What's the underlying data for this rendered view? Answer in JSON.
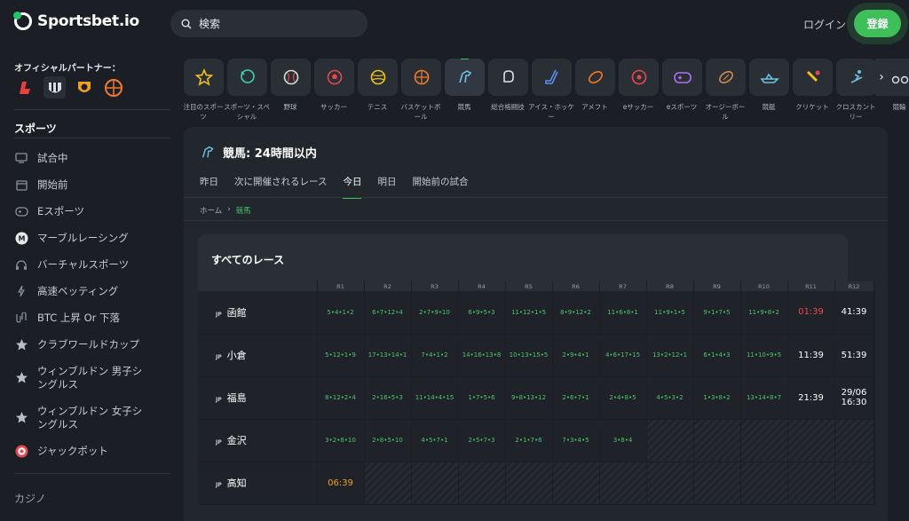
{
  "header": {
    "logo": "Sportsbet.io",
    "search_placeholder": "検索",
    "login": "ログイン",
    "register": "登録"
  },
  "sidebar": {
    "partners_title": "オフィシャルパートナー：",
    "partners": [
      {
        "icon": "laliga-logo",
        "color": "#e8413c"
      },
      {
        "icon": "newcastle-logo",
        "color": "#d9dde2"
      },
      {
        "icon": "hull-city-logo",
        "color": "#f0a020"
      },
      {
        "icon": "basketball-logo",
        "color": "#f07a2a"
      }
    ],
    "sports_title": "スポーツ",
    "items": [
      {
        "label": "試合中",
        "icon": "monitor-icon"
      },
      {
        "label": "開始前",
        "icon": "calendar-icon"
      },
      {
        "label": "Eスポーツ",
        "icon": "gamepad-icon"
      },
      {
        "label": "マーブルレーシング",
        "icon": "marble-icon"
      },
      {
        "label": "バーチャルスポーツ",
        "icon": "headset-icon"
      },
      {
        "label": "高速ベッティング",
        "icon": "lightning-icon"
      },
      {
        "label": "BTC 上昇 Or 下落",
        "icon": "bitcoin-icon"
      },
      {
        "label": "クラブワールドカップ",
        "icon": "star-icon"
      },
      {
        "label": "ウィンブルドン 男子シングルス",
        "icon": "star-icon"
      },
      {
        "label": "ウィンブルドン 女子シングルス",
        "icon": "star-icon"
      },
      {
        "label": "ジャックポット",
        "icon": "target-icon"
      }
    ],
    "casino_title": "カジノ"
  },
  "sport_strip": [
    {
      "label": "注目のスポーツ",
      "icon": "star-icon",
      "color": "#f0c020"
    },
    {
      "label": "スポーツ・スペシャル",
      "icon": "balloon-icon",
      "color": "#3fd0b0"
    },
    {
      "label": "野球",
      "icon": "baseball-icon",
      "color": "#d8d8d8"
    },
    {
      "label": "サッカー",
      "icon": "soccer-icon",
      "color": "#e5484d"
    },
    {
      "label": "テニス",
      "icon": "tennis-icon",
      "color": "#f0c020"
    },
    {
      "label": "バスケットボール",
      "icon": "basketball-icon",
      "color": "#f07a2a"
    },
    {
      "label": "競馬",
      "icon": "horse-icon",
      "color": "#6fc0e0"
    },
    {
      "label": "総合格闘技",
      "icon": "glove-icon",
      "color": "#e0e0e0"
    },
    {
      "label": "アイス・ホッケー",
      "icon": "hockey-icon",
      "color": "#5a8ef0"
    },
    {
      "label": "アメフト",
      "icon": "football-icon",
      "color": "#f07a2a"
    },
    {
      "label": "eサッカー",
      "icon": "esoccer-icon",
      "color": "#e5484d"
    },
    {
      "label": "eスポーツ",
      "icon": "controller-icon",
      "color": "#b070f0"
    },
    {
      "label": "オージーボール",
      "icon": "aussie-ball-icon",
      "color": "#d08a50"
    },
    {
      "label": "競艇",
      "icon": "boat-icon",
      "color": "#6fc0e0"
    },
    {
      "label": "クリケット",
      "icon": "cricket-icon",
      "color": "#f0c020"
    },
    {
      "label": "クロスカントリー",
      "icon": "skier-icon",
      "color": "#6fc0e0"
    },
    {
      "label": "競輪",
      "icon": "bike-icon",
      "color": "#e0e0e0"
    }
  ],
  "panel": {
    "title": "競馬: 24時間以内",
    "tabs": [
      "昨日",
      "次に開催されるレース",
      "今日",
      "明日",
      "開始前の試合"
    ],
    "active_tab": 2,
    "breadcrumb": {
      "home": "ホーム",
      "current": "競馬"
    },
    "races_title": "すべてのレース"
  },
  "race_table": {
    "columns": [
      "R1",
      "R2",
      "R3",
      "R4",
      "R5",
      "R6",
      "R7",
      "R8",
      "R9",
      "R10",
      "R11",
      "R12"
    ],
    "rows": [
      {
        "country": "JP",
        "venue": "函館",
        "cells": [
          {
            "v": "5•4•1•2",
            "k": "odds"
          },
          {
            "v": "6•7•12•4",
            "k": "odds"
          },
          {
            "v": "2•7•9•10",
            "k": "odds"
          },
          {
            "v": "6•9•5•3",
            "k": "odds"
          },
          {
            "v": "11•12•1•5",
            "k": "odds"
          },
          {
            "v": "8•9•12•2",
            "k": "odds"
          },
          {
            "v": "11•6•8•1",
            "k": "odds"
          },
          {
            "v": "11•9•1•5",
            "k": "odds"
          },
          {
            "v": "9•1•7•5",
            "k": "odds"
          },
          {
            "v": "11•9•8•2",
            "k": "odds"
          },
          {
            "v": "01:39",
            "k": "red"
          },
          {
            "v": "41:39",
            "k": "white"
          }
        ]
      },
      {
        "country": "JP",
        "venue": "小倉",
        "cells": [
          {
            "v": "5•12•1•9",
            "k": "odds"
          },
          {
            "v": "17•13•14•1",
            "k": "odds"
          },
          {
            "v": "7•4•1•2",
            "k": "odds"
          },
          {
            "v": "14•16•13•8",
            "k": "odds"
          },
          {
            "v": "10•13•15•5",
            "k": "odds"
          },
          {
            "v": "2•9•4•1",
            "k": "odds"
          },
          {
            "v": "4•6•17•15",
            "k": "odds"
          },
          {
            "v": "13•2•12•1",
            "k": "odds"
          },
          {
            "v": "6•1•4•3",
            "k": "odds"
          },
          {
            "v": "11•10•9•5",
            "k": "odds"
          },
          {
            "v": "11:39",
            "k": "white"
          },
          {
            "v": "51:39",
            "k": "white"
          }
        ]
      },
      {
        "country": "JP",
        "venue": "福島",
        "cells": [
          {
            "v": "8•12•2•4",
            "k": "odds"
          },
          {
            "v": "2•16•5•3",
            "k": "odds"
          },
          {
            "v": "11•14•4•15",
            "k": "odds"
          },
          {
            "v": "1•7•5•6",
            "k": "odds"
          },
          {
            "v": "9•8•13•12",
            "k": "odds"
          },
          {
            "v": "2•6•7•1",
            "k": "odds"
          },
          {
            "v": "2•4•8•5",
            "k": "odds"
          },
          {
            "v": "4•5•3•2",
            "k": "odds"
          },
          {
            "v": "1•3•8•2",
            "k": "odds"
          },
          {
            "v": "13•14•8•7",
            "k": "odds"
          },
          {
            "v": "21:39",
            "k": "white"
          },
          {
            "v": "29/06\n16:30",
            "k": "white"
          }
        ]
      },
      {
        "country": "JP",
        "venue": "金沢",
        "cells": [
          {
            "v": "3•2•8•10",
            "k": "odds"
          },
          {
            "v": "2•8•5•10",
            "k": "odds"
          },
          {
            "v": "4•5•7•1",
            "k": "odds"
          },
          {
            "v": "2•5•7•3",
            "k": "odds"
          },
          {
            "v": "2•1•7•6",
            "k": "odds"
          },
          {
            "v": "7•3•4•5",
            "k": "odds"
          },
          {
            "v": "3•8•4",
            "k": "odds"
          },
          {
            "v": "",
            "k": "empty"
          },
          {
            "v": "",
            "k": "empty"
          },
          {
            "v": "",
            "k": "empty"
          },
          {
            "v": "",
            "k": "empty"
          },
          {
            "v": "",
            "k": "empty"
          }
        ]
      },
      {
        "country": "JP",
        "venue": "高知",
        "cells": [
          {
            "v": "06:39",
            "k": "orange"
          },
          {
            "v": "",
            "k": "empty"
          },
          {
            "v": "",
            "k": "empty"
          },
          {
            "v": "",
            "k": "empty"
          },
          {
            "v": "",
            "k": "empty"
          },
          {
            "v": "",
            "k": "empty"
          },
          {
            "v": "",
            "k": "empty"
          },
          {
            "v": "",
            "k": "empty"
          },
          {
            "v": "",
            "k": "empty"
          },
          {
            "v": "",
            "k": "empty"
          },
          {
            "v": "",
            "k": "empty"
          },
          {
            "v": "",
            "k": "empty"
          }
        ]
      }
    ]
  },
  "colors": {
    "accent": "#3fbf5a",
    "background": "#1b1f25",
    "panel": "#22272e"
  }
}
